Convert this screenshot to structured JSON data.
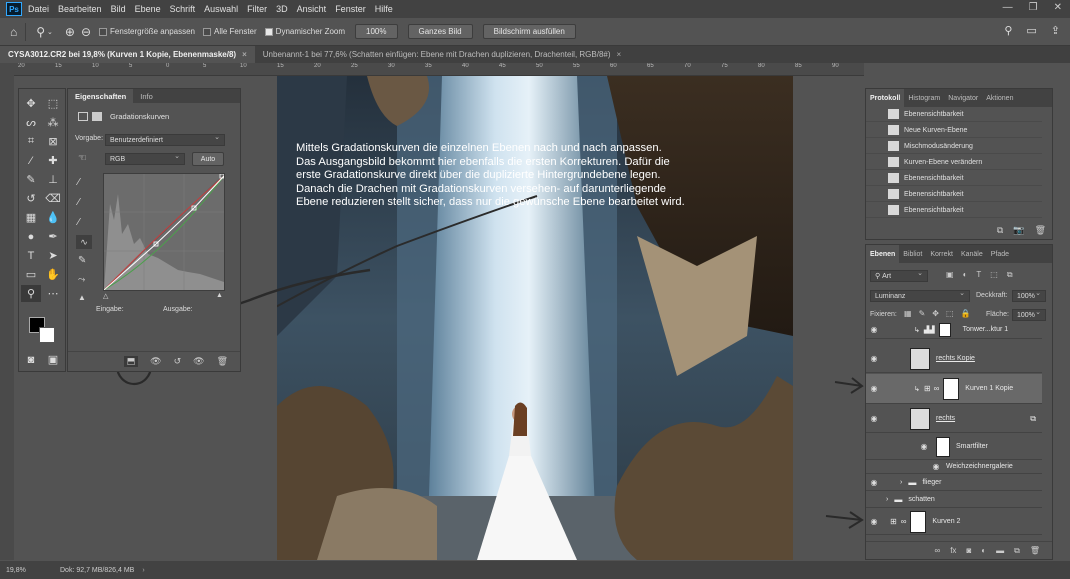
{
  "menu": [
    "Datei",
    "Bearbeiten",
    "Bild",
    "Ebene",
    "Schrift",
    "Auswahl",
    "Filter",
    "3D",
    "Ansicht",
    "Fenster",
    "Hilfe"
  ],
  "options": {
    "fit_window": "Fenstergröße anpassen",
    "all_windows": "Alle Fenster",
    "dynamic_zoom": "Dynamischer Zoom",
    "zoom_value": "100%",
    "fit_screen": "Ganzes Bild",
    "fill_screen": "Bildschirm ausfüllen"
  },
  "tabs": [
    {
      "label": "CYSA3012.CR2 bei 19,8% (Kurven 1 Kopie, Ebenenmaske/8)"
    },
    {
      "label": "Unbenannt-1 bei 77,6% (Schatten einfügen:  Ebene mit Drachen duplizieren,  Drachenteil, RGB/8#)"
    }
  ],
  "ruler": [
    "20",
    "15",
    "10",
    "5",
    "0",
    "5",
    "10",
    "15",
    "20",
    "25",
    "30",
    "35",
    "40",
    "45",
    "50",
    "55",
    "60",
    "65",
    "70",
    "75",
    "80",
    "85",
    "90"
  ],
  "properties": {
    "tabs": [
      "Eigenschaften",
      "Info"
    ],
    "title": "Gradationskurven",
    "preset_label": "Vorgabe:",
    "preset_value": "Benutzerdefiniert",
    "channel": "RGB",
    "auto": "Auto",
    "input_label": "Eingabe:",
    "output_label": "Ausgabe:"
  },
  "canvas_text": [
    "Mittels Gradationskurven die einzelnen Ebenen nach und nach anpassen.",
    "Das Ausgangsbild bekommt hier ebenfalls die ersten Korrekturen. Dafür die",
    "erste Gradationskurve direkt über die duplizierte Hintergrundebene legen.",
    "Danach die Drachen mit Gradationskurven versehen- auf darunterliegende",
    "Ebene reduzieren stellt sicher, dass nur die gewünsche Ebene bearbeitet wird."
  ],
  "history": {
    "tabs": [
      "Protokoll",
      "Histogram",
      "Navigator",
      "Aktionen"
    ],
    "items": [
      "Ebenensichtbarkeit",
      "Neue Kurven-Ebene",
      "Mischmodusänderung",
      "Kurven-Ebene verändern",
      "Ebenensichtbarkeit",
      "Ebenensichtbarkeit",
      "Ebenensichtbarkeit"
    ]
  },
  "layers": {
    "tabs": [
      "Ebenen",
      "Bibliot",
      "Korrekt",
      "Kanäle",
      "Pfade"
    ],
    "filter": "Art",
    "blend_mode": "Luminanz",
    "opacity_label": "Deckkraft:",
    "opacity_value": "100%",
    "lock_label": "Fixieren:",
    "fill_label": "Fläche:",
    "fill_value": "100%",
    "rows": [
      {
        "name": "Tonwer...ktur 1"
      },
      {
        "name": "rechts Kopie"
      },
      {
        "name": "Kurven 1 Kopie"
      },
      {
        "name": "rechts"
      },
      {
        "name": "Smartfilter"
      },
      {
        "name": "Weichzeichnergalerie"
      },
      {
        "name": "flieger"
      },
      {
        "name": "schatten"
      },
      {
        "name": "Kurven 2"
      }
    ]
  },
  "status": {
    "zoom": "19,8%",
    "doc": "Dok: 92,7 MB/826,4 MB"
  }
}
